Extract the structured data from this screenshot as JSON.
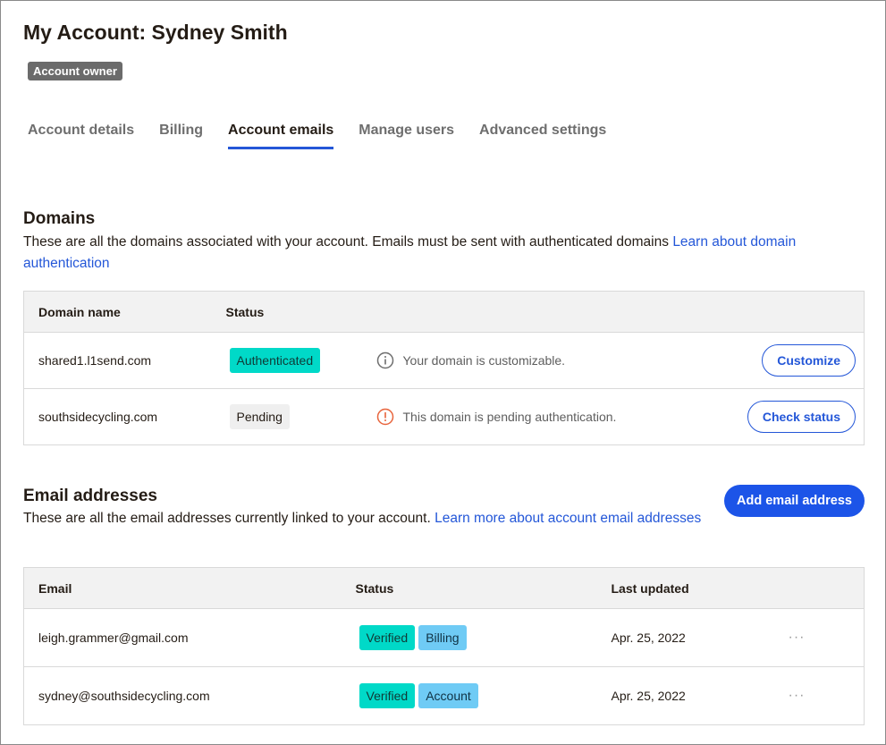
{
  "header": {
    "title": "My Account: Sydney Smith",
    "owner_badge": "Account owner"
  },
  "tabs": [
    {
      "label": "Account details",
      "active": false
    },
    {
      "label": "Billing",
      "active": false
    },
    {
      "label": "Account emails",
      "active": true
    },
    {
      "label": "Manage users",
      "active": false
    },
    {
      "label": "Advanced settings",
      "active": false
    }
  ],
  "domains": {
    "title": "Domains",
    "description": "These are all the domains associated with your account. Emails must be sent with authenticated domains ",
    "link": "Learn about domain authentication",
    "columns": {
      "name": "Domain name",
      "status": "Status"
    },
    "rows": [
      {
        "name": "shared1.l1send.com",
        "status": "Authenticated",
        "note": "Your domain is customizable.",
        "note_icon": "info-icon",
        "action": "Customize"
      },
      {
        "name": "southsidecycling.com",
        "status": "Pending",
        "note": "This domain is pending authentication.",
        "note_icon": "warning-icon",
        "action": "Check status"
      }
    ]
  },
  "emails": {
    "title": "Email addresses",
    "description": "These are all the email addresses currently linked to your account. ",
    "link": "Learn more about account email addresses",
    "add_button": "Add email address",
    "columns": {
      "email": "Email",
      "status": "Status",
      "updated": "Last updated"
    },
    "rows": [
      {
        "email": "leigh.grammer@gmail.com",
        "status": "Verified",
        "role": "Billing",
        "updated": "Apr. 25, 2022",
        "more": "···"
      },
      {
        "email": "sydney@southsidecycling.com",
        "status": "Verified",
        "role": "Account",
        "updated": "Apr. 25, 2022",
        "more": "···"
      }
    ]
  },
  "colors": {
    "accent": "#1c54e8",
    "teal": "#00d9c8",
    "light_blue": "#6fcbf5",
    "warning": "#e8643c"
  }
}
